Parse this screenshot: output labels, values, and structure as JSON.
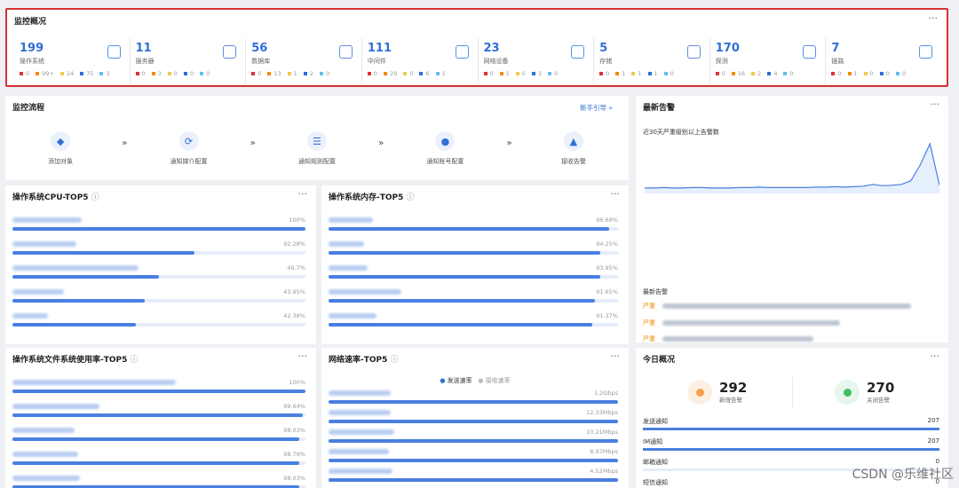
{
  "overview": {
    "title": "监控概况",
    "more": "···",
    "tiles": [
      {
        "value": "199",
        "label": "操作系统",
        "stats": [
          "0",
          "99+",
          "14",
          "75",
          "3"
        ]
      },
      {
        "value": "11",
        "label": "服务器",
        "stats": [
          "0",
          "3",
          "0",
          "0",
          "0"
        ]
      },
      {
        "value": "56",
        "label": "数据库",
        "stats": [
          "0",
          "13",
          "1",
          "2",
          "0"
        ]
      },
      {
        "value": "111",
        "label": "中间件",
        "stats": [
          "0",
          "29",
          "0",
          "6",
          "1"
        ]
      },
      {
        "value": "23",
        "label": "网络设备",
        "stats": [
          "0",
          "1",
          "0",
          "3",
          "0"
        ]
      },
      {
        "value": "5",
        "label": "存储",
        "stats": [
          "0",
          "1",
          "1",
          "1",
          "0"
        ]
      },
      {
        "value": "170",
        "label": "探测",
        "stats": [
          "0",
          "16",
          "2",
          "4",
          "0"
        ]
      },
      {
        "value": "7",
        "label": "链路",
        "stats": [
          "0",
          "1",
          "0",
          "0",
          "0"
        ]
      }
    ],
    "stat_colors": [
      "#e03131",
      "#f08c00",
      "#f2c94c",
      "#2f6fd6",
      "#5ec2e8"
    ]
  },
  "flow": {
    "title": "监控流程",
    "guide": "新手引导 »",
    "more": "···",
    "steps": [
      {
        "label": "添加对象"
      },
      {
        "label": "通知媒介配置"
      },
      {
        "label": "通知规则配置"
      },
      {
        "label": "通知账号配置"
      },
      {
        "label": "接收告警"
      }
    ],
    "arrow": "»"
  },
  "alarm": {
    "title": "最新告警",
    "more": "···",
    "trend_label": "近30天严重级别以上告警数",
    "list_label": "最新告警",
    "severity": "严重",
    "trend": [
      0.04,
      0.04,
      0.05,
      0.04,
      0.04,
      0.05,
      0.05,
      0.04,
      0.04,
      0.04,
      0.05,
      0.05,
      0.06,
      0.05,
      0.05,
      0.05,
      0.05,
      0.05,
      0.06,
      0.06,
      0.07,
      0.06,
      0.07,
      0.08,
      0.12,
      0.09,
      0.1,
      0.12,
      0.2,
      0.55,
      1.0,
      0.1
    ]
  },
  "cpu": {
    "title": "操作系统CPU-TOP5",
    "values": [
      "100%",
      "92.28%",
      "49.7%",
      "43.95%",
      "42.38%"
    ],
    "fills": [
      1.0,
      0.62,
      0.5,
      0.45,
      0.42
    ]
  },
  "mem": {
    "title": "操作系统内存-TOP5",
    "values": [
      "96.68%",
      "94.25%",
      "93.95%",
      "91.65%",
      "91.37%"
    ],
    "fills": [
      0.97,
      0.94,
      0.94,
      0.92,
      0.91
    ]
  },
  "fs": {
    "title": "操作系统文件系统使用率-TOP5",
    "values": [
      "100%",
      "99.64%",
      "98.03%",
      "98.79%",
      "98.03%"
    ],
    "fills": [
      1.0,
      0.99,
      0.98,
      0.98,
      0.98
    ]
  },
  "net": {
    "title": "网络速率-TOP5",
    "legend_send": "发送速率",
    "legend_recv": "接收速率",
    "values": [
      "1.2Gbps",
      "12.33Mbps",
      "10.21Mbps",
      "8.97Mbps",
      "4.52Mbps"
    ],
    "fills": [
      1.0,
      1.0,
      1.0,
      1.0,
      1.0
    ]
  },
  "today": {
    "title": "今日概况",
    "more": "···",
    "new_alarm": {
      "value": "292",
      "label": "新增告警"
    },
    "closed_alarm": {
      "value": "270",
      "label": "关闭告警"
    },
    "notices": [
      {
        "label": "发送通知",
        "value": "207",
        "fill": 1.0
      },
      {
        "label": "IM通知",
        "value": "207",
        "fill": 1.0
      },
      {
        "label": "邮箱通知",
        "value": "0",
        "fill": 0
      },
      {
        "label": "短信通知",
        "value": "0",
        "fill": 0
      }
    ]
  },
  "watermark": "CSDN @乐维社区"
}
